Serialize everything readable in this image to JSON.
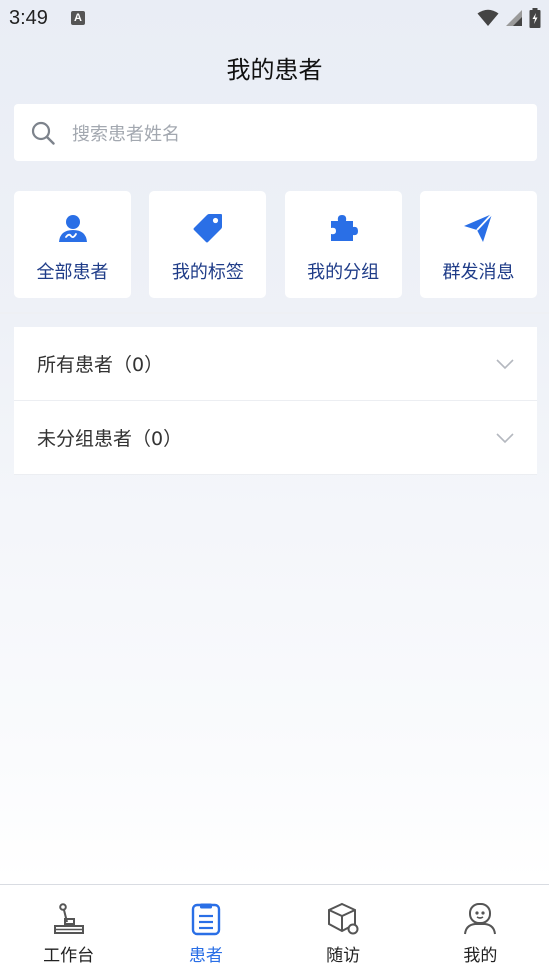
{
  "status_bar": {
    "time": "3:49",
    "notification_badge": "A"
  },
  "header": {
    "title": "我的患者"
  },
  "search": {
    "placeholder": "搜索患者姓名"
  },
  "quick_actions": [
    {
      "label": "全部患者",
      "icon": "patient-icon"
    },
    {
      "label": "我的标签",
      "icon": "tag-icon"
    },
    {
      "label": "我的分组",
      "icon": "puzzle-icon"
    },
    {
      "label": "群发消息",
      "icon": "send-icon"
    }
  ],
  "groups": [
    {
      "label": "所有患者（0）"
    },
    {
      "label": "未分组患者（0）"
    }
  ],
  "tab_bar": {
    "active": "患者",
    "tabs": [
      {
        "label": "工作台",
        "icon": "workbench-icon"
      },
      {
        "label": "患者",
        "icon": "patient-list-icon"
      },
      {
        "label": "随访",
        "icon": "follow-up-icon"
      },
      {
        "label": "我的",
        "icon": "profile-icon"
      }
    ]
  },
  "colors": {
    "accent": "#2a6fe6",
    "quick_label": "#1f3c88",
    "background": "#eef1f7"
  }
}
